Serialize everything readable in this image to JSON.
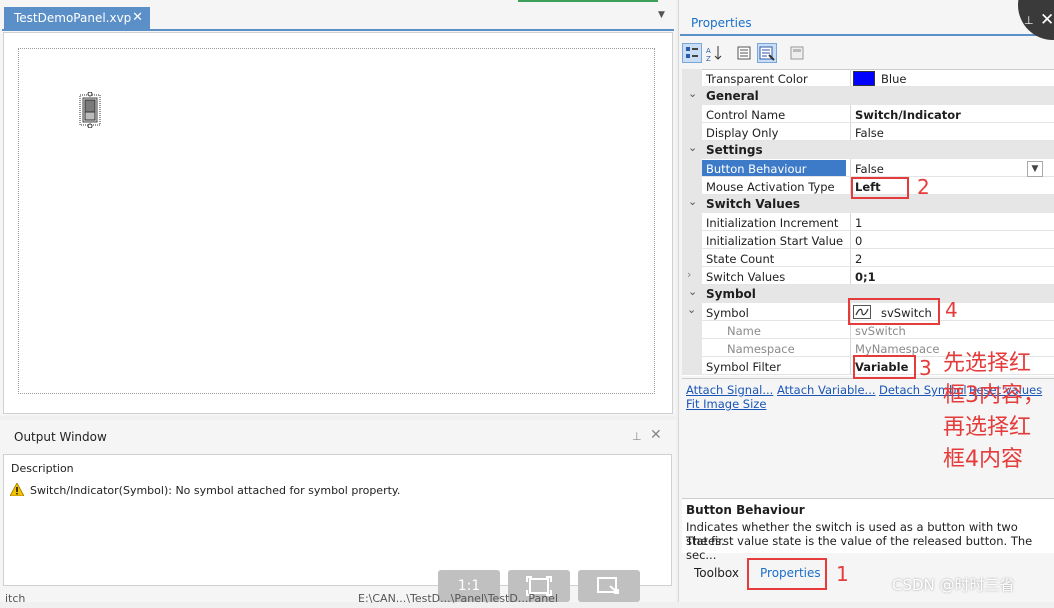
{
  "document_tab": {
    "title": "TestDemoPanel.xvp",
    "close": "✕"
  },
  "output_window": {
    "title": "Output Window",
    "column_header": "Description",
    "messages": [
      {
        "type": "warning",
        "text": "Switch/Indicator(Symbol): No symbol attached for symbol property."
      }
    ]
  },
  "zoom_controls": [
    "1:1",
    "fit-screen-icon",
    "fit-selection-icon"
  ],
  "status_bar": {
    "left": "itch",
    "middle": "E:\\CAN...\\TestD...\\Panel\\TestD...Panel"
  },
  "properties": {
    "title": "Properties",
    "toolbar": [
      "categorized-icon",
      "alphabetical-icon",
      "property-pages-icon",
      "events-icon",
      "settings-icon"
    ],
    "rows": [
      {
        "kind": "prop",
        "name": "Transparent Color",
        "value": "Blue"
      },
      {
        "kind": "cat",
        "name": "General"
      },
      {
        "kind": "prop",
        "name": "Control Name",
        "value": "Switch/Indicator"
      },
      {
        "kind": "prop",
        "name": "Display Only",
        "value": "False"
      },
      {
        "kind": "cat",
        "name": "Settings"
      },
      {
        "kind": "prop",
        "name": "Button Behaviour",
        "value": "False"
      },
      {
        "kind": "prop",
        "name": "Mouse Activation Type",
        "value": "Left"
      },
      {
        "kind": "cat",
        "name": "Switch Values"
      },
      {
        "kind": "prop",
        "name": "Initialization Increment",
        "value": "1"
      },
      {
        "kind": "prop",
        "name": "Initialization Start Value",
        "value": "0"
      },
      {
        "kind": "prop",
        "name": "State Count",
        "value": "2"
      },
      {
        "kind": "prop",
        "name": "Switch Values",
        "value": "0;1"
      },
      {
        "kind": "cat",
        "name": "Symbol"
      },
      {
        "kind": "prop",
        "name": "Symbol",
        "value": "svSwitch"
      },
      {
        "kind": "prop",
        "name": "Name",
        "value": "svSwitch"
      },
      {
        "kind": "prop",
        "name": "Namespace",
        "value": "MyNamespace"
      },
      {
        "kind": "prop",
        "name": "Symbol Filter",
        "value": "Variable"
      }
    ],
    "transparent_color_hex": "#0000ff",
    "links": [
      "Attach Signal...",
      "Attach Variable...",
      "Detach Symbol",
      "Reset values",
      "Fit Image Size"
    ],
    "description": {
      "title": "Button Behaviour",
      "line1": "Indicates whether the switch is used as a button with two states.",
      "line2": "The first value state is the value of the released button. The sec..."
    },
    "bottom_tabs": [
      "Toolbox",
      "Properties"
    ]
  },
  "annotations": {
    "numbers": [
      "1",
      "2",
      "3",
      "4"
    ],
    "note": "先选择红框3内容，再选择红框4内容",
    "color": "#e53b3b"
  },
  "watermark": "CSDN @时时三省"
}
